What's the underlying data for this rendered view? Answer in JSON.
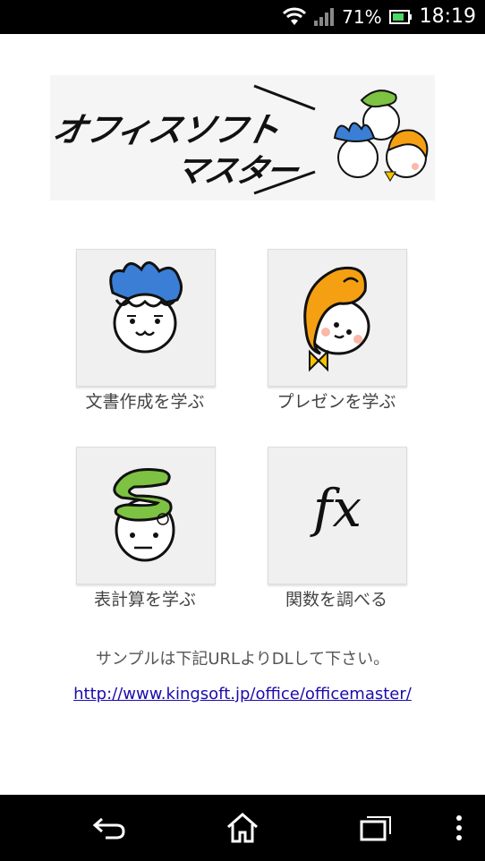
{
  "status": {
    "battery": "71%",
    "time": "18:19"
  },
  "banner": {
    "title_line1": "オフィスソフト",
    "title_line2": "マスター"
  },
  "menu": [
    {
      "label": "文書作成を学ぶ",
      "icon": "blue-hair-character-icon"
    },
    {
      "label": "プレゼンを学ぶ",
      "icon": "orange-hair-girl-icon"
    },
    {
      "label": "表計算を学ぶ",
      "icon": "green-hair-character-icon"
    },
    {
      "label": "関数を調べる",
      "icon": "fx-function-icon",
      "icon_text": "fx"
    }
  ],
  "note": "サンプルは下記URLよりDLして下さい。",
  "link": "http://www.kingsoft.jp/office/officemaster/",
  "colors": {
    "blue": "#3a7fd5",
    "orange": "#f5a012",
    "green": "#7dc242"
  }
}
